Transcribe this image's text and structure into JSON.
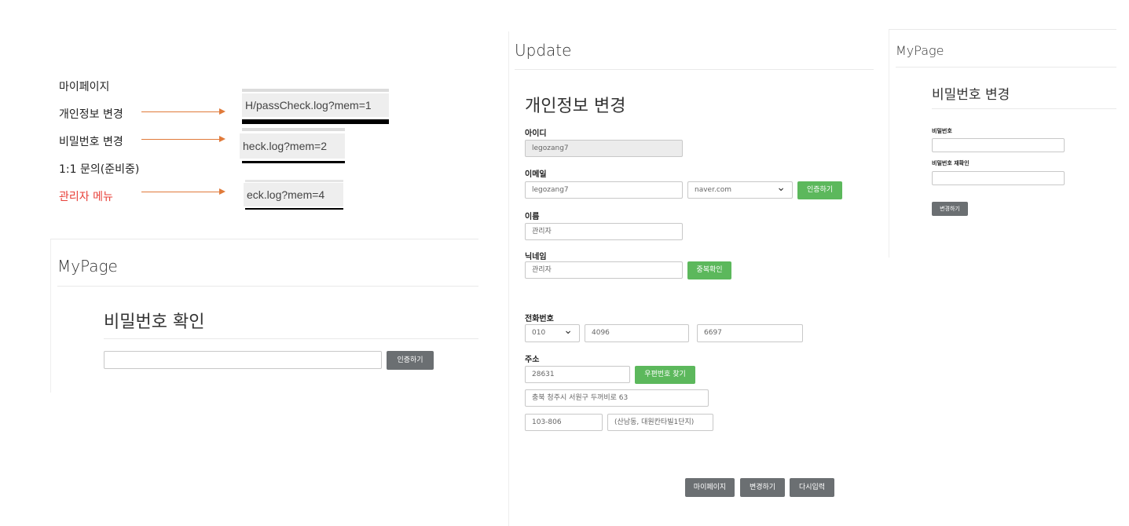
{
  "annot_menu": {
    "items": [
      "마이페이지",
      "개인정보 변경",
      "비밀번호 변경",
      "1:1 문의(준비중)",
      "관리자 메뉴"
    ],
    "urls": [
      "H/passCheck.log?mem=1",
      "heck.log?mem=2",
      "eck.log?mem=4"
    ],
    "arrow_color": "#e07a3a",
    "admin_color": "#e8413a"
  },
  "password_check_panel": {
    "title": "MyPage",
    "heading": "비밀번호 확인",
    "input_value": "",
    "button": "인증하기"
  },
  "update_panel": {
    "title": "Update",
    "heading": "개인정보 변경",
    "id_label": "아이디",
    "id_value": "legozang7",
    "email_label": "이메일",
    "email_value": "legozang7",
    "email_domain": "naver.com",
    "email_button": "인증하기",
    "name_label": "이름",
    "name_value": "관리자",
    "nick_label": "닉네임",
    "nick_value": "관리자",
    "nick_button": "중복확인",
    "phone_label": "전화번호",
    "phone_prefix": "010",
    "phone_mid": "4096",
    "phone_last": "6697",
    "address_label": "주소",
    "postcode": "28631",
    "postcode_button": "우편번호 찾기",
    "address1": "충북 청주시 서원구 두꺼비로 63",
    "address2": "103-806",
    "address3": "(산남동, 대원칸타빌1단지)",
    "buttons": [
      "마이페이지",
      "변경하기",
      "다시입력"
    ]
  },
  "password_change_panel": {
    "title": "MyPage",
    "heading": "비밀번호 변경",
    "pw_label": "비밀번호",
    "pw_value": "",
    "pw_confirm_label": "비밀번호 재확인",
    "pw_confirm_value": "",
    "button": "변경하기"
  },
  "colors": {
    "green": "#5cb85c",
    "gray_button": "#6b6f72"
  }
}
